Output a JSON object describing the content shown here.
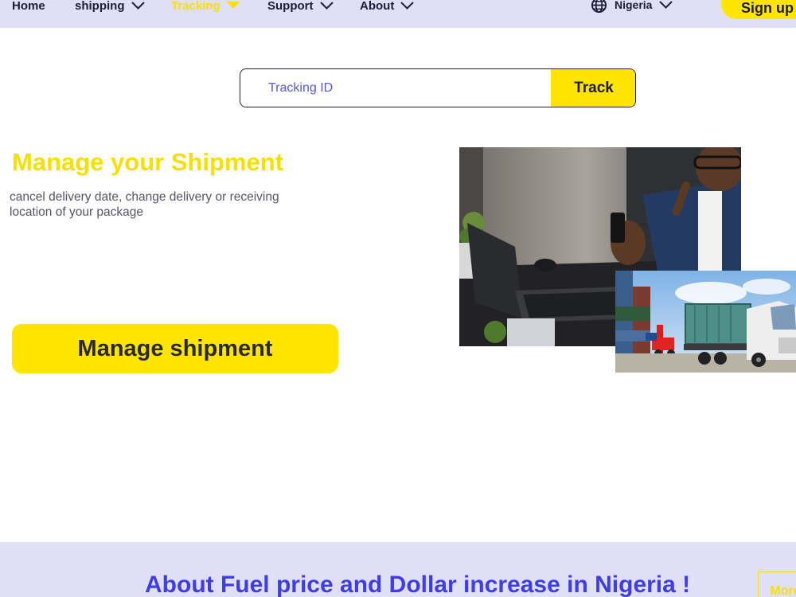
{
  "nav": {
    "home": "Home",
    "shipping": "shipping",
    "tracking": "Tracking",
    "support": "Support",
    "about": "About",
    "country": "Nigeria",
    "signup": "Sign up"
  },
  "track": {
    "placeholder": "Tracking ID",
    "button": "Track"
  },
  "hero": {
    "title": "Manage your Shipment",
    "description": "cancel delivery date, change delivery or receiving location of your package",
    "button": "Manage shipment"
  },
  "banner": {
    "title": "About Fuel price and Dollar increase in Nigeria !",
    "more": "More"
  },
  "colors": {
    "nav_bg": "#e1dff8",
    "accent_yellow": "#ffe500",
    "banner_blue": "#3d3ee6"
  },
  "icons": {
    "dropdown": "chevron-down-icon",
    "active_dropdown": "caret-down-icon",
    "language": "globe-icon"
  }
}
